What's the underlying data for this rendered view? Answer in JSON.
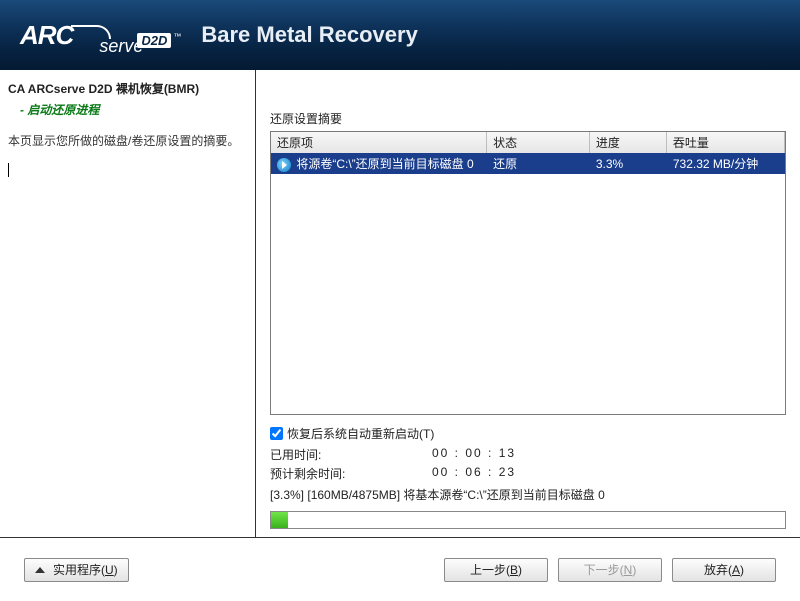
{
  "header": {
    "logo_arc": "ARC",
    "logo_serve": "serve",
    "logo_d2d": "D2D",
    "logo_tm": "™",
    "title": "Bare Metal Recovery"
  },
  "sidebar": {
    "title": "CA ARCserve D2D 裸机恢复(BMR)",
    "subtitle": "- 启动还原进程",
    "desc": "本页显示您所做的磁盘/卷还原设置的摘要。"
  },
  "main": {
    "summary_label": "还原设置摘要",
    "columns": {
      "item": "还原项",
      "status": "状态",
      "progress": "进度",
      "throughput": "吞吐量"
    },
    "row": {
      "item": "将源卷“C:\\”还原到当前目标磁盘 0",
      "status": "还原",
      "progress": "3.3%",
      "throughput": "732.32 MB/分钟"
    },
    "checkbox_label": "恢复后系统自动重新启动(T)",
    "elapsed_label": "已用时间:",
    "elapsed_value": "00 : 00 : 13",
    "remaining_label": "预计剩余时间:",
    "remaining_value": "00 : 06 : 23",
    "status_line": "[3.3%] [160MB/4875MB] 将基本源卷“C:\\”还原到当前目标磁盘 0",
    "progress_pct": 3.3
  },
  "footer": {
    "utilities": "实用程序(",
    "utilities_hot": "U",
    "utilities_end": ")",
    "back": "上一步(",
    "back_hot": "B",
    "back_end": ")",
    "next": "下一步(",
    "next_hot": "N",
    "next_end": ")",
    "abort": "放弃(",
    "abort_hot": "A",
    "abort_end": ")"
  }
}
